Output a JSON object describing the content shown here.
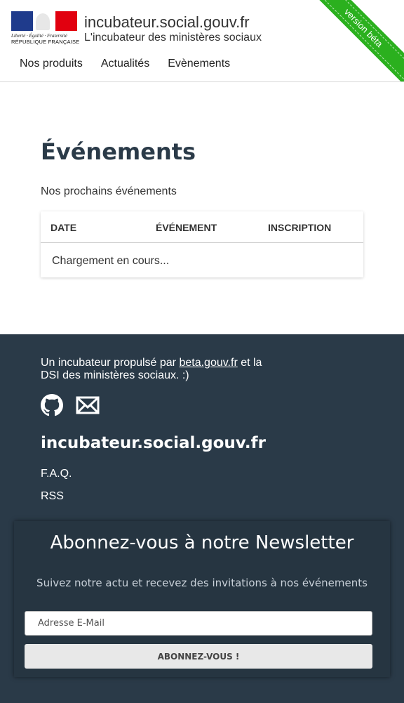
{
  "header": {
    "logo_motto": "Liberté · Égalité · Fraternité",
    "logo_rf": "RÉPUBLIQUE FRANÇAISE",
    "site_title": "incubateur.social.gouv.fr",
    "site_tagline": "L'incubateur des ministères sociaux",
    "beta_ribbon": "version béta",
    "nav": [
      "Nos produits",
      "Actualités",
      "Evènements"
    ]
  },
  "main": {
    "title": "Événements",
    "subtitle": "Nos prochains événements",
    "table": {
      "columns": [
        "DATE",
        "ÉVÉNEMENT",
        "INSCRIPTION"
      ],
      "loading_text": "Chargement en cours..."
    }
  },
  "footer": {
    "credit_before": "Un incubateur propulsé par ",
    "credit_link": "beta.gouv.fr",
    "credit_after": " et la DSI des ministères sociaux. :)",
    "site_name": "incubateur.social.gouv.fr",
    "links": [
      "F.A.Q.",
      "RSS"
    ],
    "icons": [
      "github-icon",
      "mail-icon"
    ]
  },
  "newsletter": {
    "title": "Abonnez-vous à notre Newsletter",
    "subtitle": "Suivez notre actu et recevez des invitations à nos événements",
    "email_placeholder": "Adresse E-Mail",
    "button_label": "ABONNEZ-VOUS !"
  },
  "colors": {
    "footer_bg": "#2a3a48",
    "ribbon": "#2bb01e",
    "flag_blue": "#1f3b8c",
    "flag_red": "#e1000f"
  }
}
